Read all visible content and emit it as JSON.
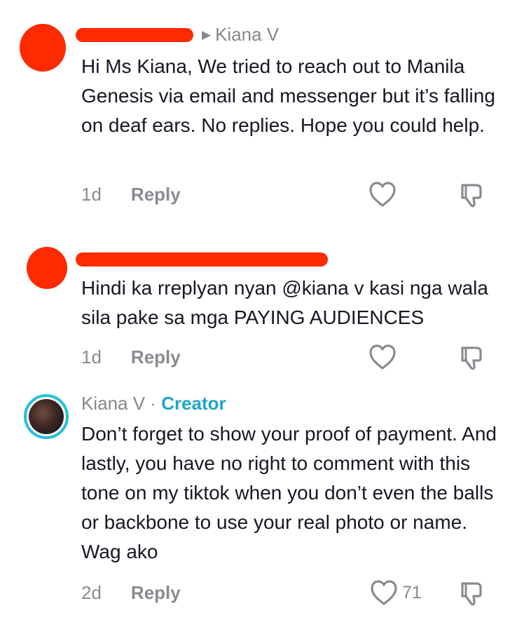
{
  "comments": [
    {
      "reply_to": "Kiana V",
      "text": "Hi Ms Kiana, We tried to reach out to Manila Genesis via email and messenger but it’s falling on deaf ears. No replies. Hope you could help.",
      "time": "1d",
      "reply_label": "Reply"
    },
    {
      "text": "Hindi ka rreplyan nyan @kiana v kasi nga wala sila pake sa mga PAYING AUDIENCES",
      "time": "1d",
      "reply_label": "Reply"
    },
    {
      "author": "Kiana V",
      "separator": " · ",
      "badge": "Creator",
      "text": "Don’t forget to show your proof of payment. And lastly, you have no right to comment with this tone on my tiktok when you don’t even the balls or backbone to use your real photo or name. Wag ako",
      "time": "2d",
      "reply_label": "Reply",
      "likes": "71"
    }
  ],
  "colors": {
    "redaction": "#ff2a00",
    "creator_badge": "#1fa6c8",
    "muted": "#8a8b91"
  },
  "icons": [
    "heart-icon",
    "dislike-icon",
    "caret-right-icon"
  ]
}
